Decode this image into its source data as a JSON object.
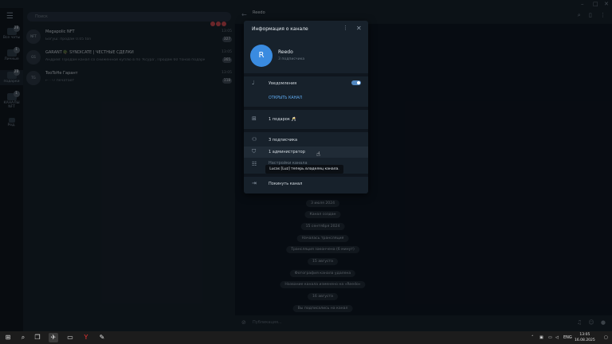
{
  "window": {
    "minimize": "–",
    "maximize": "□",
    "close": "✕"
  },
  "folders": [
    {
      "label": "Все чаты",
      "badge": "28",
      "icon": "chat-bubble-icon"
    },
    {
      "label": "Личные",
      "badge": "1",
      "icon": "person-icon"
    },
    {
      "label": "подарки",
      "badge": "28",
      "icon": "gift-folder-icon"
    },
    {
      "label": "КАНАЛЫ NFT",
      "badge": "1",
      "icon": "folder-icon"
    },
    {
      "label": "Ред.",
      "badge": "",
      "icon": "edit-icon"
    }
  ],
  "search": {
    "placeholder": "Поиск"
  },
  "chats": [
    {
      "name": "Megapolic NFT",
      "time": "13:05",
      "message": "Богуш: продам 0.05 ton",
      "count": "327",
      "avatar": "NFT"
    },
    {
      "name": "GARANT 🪖 SYNDICATE | ЧЕСТНЫЕ СДЕЛКИ",
      "time": "13:05",
      "message": "Андрей: Продам канал со сниженной куплю в по 'Ксура', Продам 60 тонов подарками...",
      "count": "365",
      "avatar": "GS"
    },
    {
      "name": "TooToHe Гарант",
      "time": "13:05",
      "message": "⇠ · ⚇ печатает",
      "count": "118",
      "avatar": "TG"
    }
  ],
  "chat_header": {
    "title": "Reedo",
    "back": "←"
  },
  "timeline": [
    "3 июля 2024",
    "Канал создан",
    "15 сентября 2024",
    "Началась трансляция",
    "Трансляция закончена (6 минут)",
    "15 августа",
    "Фотография канала удалена",
    "Название канала изменено на «Reedo»",
    "16 августа",
    "Вы подписались на канал"
  ],
  "composer": {
    "placeholder": "Публикация..."
  },
  "modal": {
    "title": "Информация о канале",
    "avatar_letter": "R",
    "channel_name": "Reedo",
    "subscribers_sub": "3 подписчика",
    "notifications": "Уведомления",
    "open_channel": "ОТКРЫТЬ КАНАЛ",
    "gifts": "1 подарок 🥂",
    "subscribers": "3 подписчика",
    "admins": "1 администратор",
    "settings": "Настройки канала",
    "leave": "Покинуть канал",
    "tooltip": "Lucas [Luz] теперь владелец канала."
  },
  "taskbar": {
    "lang": "ENG",
    "time": "13:05",
    "date": "16.08.2025"
  },
  "colors": {
    "accent": "#5288c1",
    "avatar": "#3a8be0",
    "link": "#5eaaf0"
  }
}
